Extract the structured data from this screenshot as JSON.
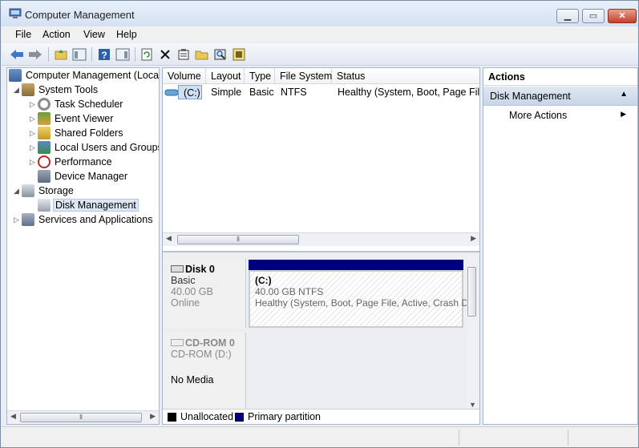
{
  "window": {
    "title": "Computer Management"
  },
  "menu": [
    {
      "label": "File",
      "key": "F"
    },
    {
      "label": "Action",
      "key": "A"
    },
    {
      "label": "View",
      "key": "V"
    },
    {
      "label": "Help",
      "key": "H"
    }
  ],
  "toolbar": {
    "icons": [
      "back-arrow-icon",
      "forward-arrow-icon",
      "up-folder-icon",
      "show-hide-tree-icon",
      "help-icon",
      "show-hide-action-pane-icon",
      "refresh-icon",
      "delete-icon",
      "properties-icon",
      "open-icon",
      "search-icon",
      "disk-properties-icon"
    ]
  },
  "tree": {
    "root": "Computer Management (Local",
    "system_tools": "System Tools",
    "task_scheduler": "Task Scheduler",
    "event_viewer": "Event Viewer",
    "shared_folders": "Shared Folders",
    "local_users": "Local Users and Groups",
    "performance": "Performance",
    "device_manager": "Device Manager",
    "storage": "Storage",
    "disk_management": "Disk Management",
    "services": "Services and Applications"
  },
  "volumes": {
    "columns": [
      "Volume",
      "Layout",
      "Type",
      "File System",
      "Status"
    ],
    "rows": [
      {
        "volume": "(C:)",
        "layout": "Simple",
        "type": "Basic",
        "fs": "NTFS",
        "status": "Healthy (System, Boot, Page File, A"
      }
    ]
  },
  "disks": {
    "disk0": {
      "name": "Disk 0",
      "type": "Basic",
      "size": "40.00 GB",
      "state": "Online"
    },
    "partition": {
      "name": "(C:)",
      "size": "40.00 GB NTFS",
      "status": "Healthy (System, Boot, Page File, Active, Crash D"
    },
    "cdrom": {
      "name": "CD-ROM 0",
      "drive": "CD-ROM (D:)",
      "media": "No Media"
    }
  },
  "legend": {
    "unallocated": "Unallocated",
    "primary": "Primary partition",
    "colors": {
      "unallocated": "#000000",
      "primary": "#00007f"
    }
  },
  "actions": {
    "header": "Actions",
    "section": "Disk Management",
    "more": "More Actions"
  }
}
